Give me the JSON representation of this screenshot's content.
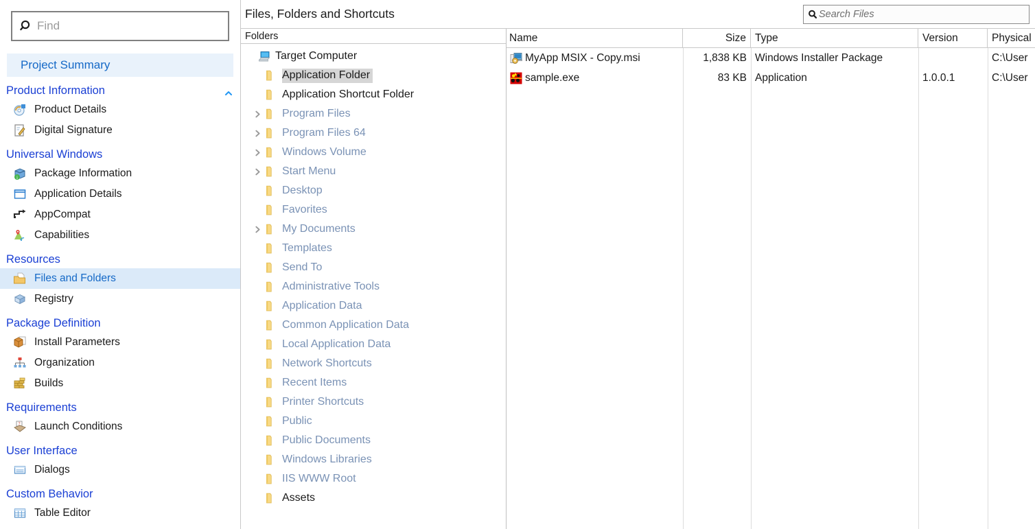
{
  "sidebar": {
    "find": {
      "placeholder": "Find",
      "value": "",
      "icon": "search-icon"
    },
    "project_summary": "Project Summary",
    "groups": [
      {
        "title": "Product Information",
        "collapse_icon": "chevron-up-icon",
        "items": [
          {
            "label": "Product Details",
            "icon": "product-details-icon"
          },
          {
            "label": "Digital Signature",
            "icon": "digital-signature-icon"
          }
        ]
      },
      {
        "title": "Universal Windows",
        "items": [
          {
            "label": "Package Information",
            "icon": "package-information-icon"
          },
          {
            "label": "Application Details",
            "icon": "application-details-icon"
          },
          {
            "label": "AppCompat",
            "icon": "appcompat-icon"
          },
          {
            "label": "Capabilities",
            "icon": "capabilities-icon"
          }
        ]
      },
      {
        "title": "Resources",
        "items": [
          {
            "label": "Files and Folders",
            "icon": "files-and-folders-icon",
            "selected": true
          },
          {
            "label": "Registry",
            "icon": "registry-icon"
          }
        ]
      },
      {
        "title": "Package Definition",
        "items": [
          {
            "label": "Install Parameters",
            "icon": "install-parameters-icon"
          },
          {
            "label": "Organization",
            "icon": "organization-icon"
          },
          {
            "label": "Builds",
            "icon": "builds-icon"
          }
        ]
      },
      {
        "title": "Requirements",
        "items": [
          {
            "label": "Launch Conditions",
            "icon": "launch-conditions-icon"
          }
        ]
      },
      {
        "title": "User Interface",
        "items": [
          {
            "label": "Dialogs",
            "icon": "dialogs-icon"
          }
        ]
      },
      {
        "title": "Custom Behavior",
        "items": [
          {
            "label": "Table Editor",
            "icon": "table-editor-icon"
          }
        ]
      }
    ]
  },
  "main": {
    "title": "Files, Folders and Shortcuts",
    "search": {
      "placeholder": "Search Files",
      "value": "",
      "icon": "search-icon"
    },
    "tree_pane": {
      "column_header": "Folders",
      "nodes": [
        {
          "label": "Target Computer",
          "depth": 0,
          "icon": "computer-icon",
          "arrow": "none",
          "style": "strong"
        },
        {
          "label": "Application Folder",
          "depth": 1,
          "icon": "folder-icon",
          "arrow": "none",
          "style": "strong",
          "selected": true
        },
        {
          "label": "Application Shortcut Folder",
          "depth": 1,
          "icon": "folder-icon",
          "arrow": "none",
          "style": "strong"
        },
        {
          "label": "Program Files",
          "depth": 1,
          "icon": "folder-icon",
          "arrow": "collapsed",
          "style": "dim"
        },
        {
          "label": "Program Files 64",
          "depth": 1,
          "icon": "folder-icon",
          "arrow": "collapsed",
          "style": "dim"
        },
        {
          "label": "Windows Volume",
          "depth": 1,
          "icon": "folder-icon",
          "arrow": "collapsed",
          "style": "dim"
        },
        {
          "label": "Start Menu",
          "depth": 1,
          "icon": "folder-icon",
          "arrow": "collapsed",
          "style": "dim"
        },
        {
          "label": "Desktop",
          "depth": 1,
          "icon": "folder-icon",
          "arrow": "none",
          "style": "dim"
        },
        {
          "label": "Favorites",
          "depth": 1,
          "icon": "folder-icon",
          "arrow": "none",
          "style": "dim"
        },
        {
          "label": "My Documents",
          "depth": 1,
          "icon": "folder-icon",
          "arrow": "collapsed",
          "style": "dim"
        },
        {
          "label": "Templates",
          "depth": 1,
          "icon": "folder-icon",
          "arrow": "none",
          "style": "dim"
        },
        {
          "label": "Send To",
          "depth": 1,
          "icon": "folder-icon",
          "arrow": "none",
          "style": "dim"
        },
        {
          "label": "Administrative Tools",
          "depth": 1,
          "icon": "folder-icon",
          "arrow": "none",
          "style": "dim"
        },
        {
          "label": "Application Data",
          "depth": 1,
          "icon": "folder-icon",
          "arrow": "none",
          "style": "dim"
        },
        {
          "label": "Common Application Data",
          "depth": 1,
          "icon": "folder-icon",
          "arrow": "none",
          "style": "dim"
        },
        {
          "label": "Local Application Data",
          "depth": 1,
          "icon": "folder-icon",
          "arrow": "none",
          "style": "dim"
        },
        {
          "label": "Network Shortcuts",
          "depth": 1,
          "icon": "folder-icon",
          "arrow": "none",
          "style": "dim"
        },
        {
          "label": "Recent Items",
          "depth": 1,
          "icon": "folder-icon",
          "arrow": "none",
          "style": "dim"
        },
        {
          "label": "Printer Shortcuts",
          "depth": 1,
          "icon": "folder-icon",
          "arrow": "none",
          "style": "dim"
        },
        {
          "label": "Public",
          "depth": 1,
          "icon": "folder-icon",
          "arrow": "none",
          "style": "dim"
        },
        {
          "label": "Public Documents",
          "depth": 1,
          "icon": "folder-icon",
          "arrow": "none",
          "style": "dim"
        },
        {
          "label": "Windows Libraries",
          "depth": 1,
          "icon": "folder-icon",
          "arrow": "none",
          "style": "dim"
        },
        {
          "label": "IIS WWW Root",
          "depth": 1,
          "icon": "folder-icon",
          "arrow": "none",
          "style": "dim"
        },
        {
          "label": "Assets",
          "depth": 1,
          "icon": "folder-icon",
          "arrow": "none",
          "style": "strong"
        }
      ]
    },
    "file_list": {
      "columns": [
        "Name",
        "Size",
        "Type",
        "Version",
        "Physical"
      ],
      "rows": [
        {
          "icon": "msi-package-icon",
          "name": "MyApp MSIX - Copy.msi",
          "size": "1,838 KB",
          "type": "Windows Installer Package",
          "version": "",
          "physical": "C:\\User"
        },
        {
          "icon": "exe-application-icon",
          "name": "sample.exe",
          "size": "83 KB",
          "type": "Application",
          "version": "1.0.0.1",
          "physical": "C:\\User"
        }
      ]
    }
  },
  "colors": {
    "group_header": "#1a3fd4",
    "selected_nav_bg": "#dbeaf9",
    "selected_nav_text": "#1569c7",
    "project_summary_bg": "#e9f2fb",
    "tree_dim_text": "#7a92b5",
    "tree_selected_bg": "#d6d6d6",
    "folder_yellow": "#f6d268",
    "panel_border": "#c8c8c8"
  }
}
